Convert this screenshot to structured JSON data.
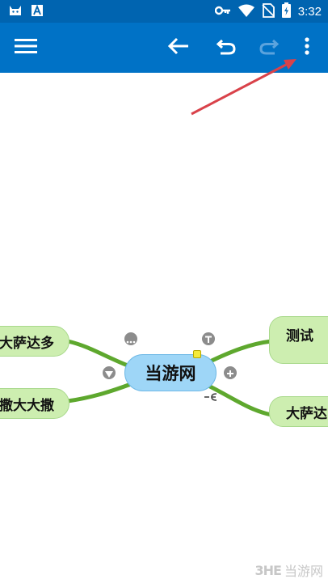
{
  "status_bar": {
    "time": "3:32",
    "left_icons": [
      "cat-notification-icon",
      "text-a-notification-icon"
    ],
    "right_icons": [
      "key-icon",
      "wifi-icon",
      "no-sim-icon",
      "battery-charging-icon"
    ]
  },
  "app_bar": {
    "color": "#0072c6",
    "buttons": [
      "menu-icon",
      "back-arrow-icon",
      "undo-icon",
      "redo-icon",
      "more-vert-icon"
    ]
  },
  "mind_map": {
    "central": {
      "label": "当游网"
    },
    "branches": [
      {
        "label": "大萨达多"
      },
      {
        "label": "撒大大撒"
      },
      {
        "label": "测试"
      },
      {
        "label": "大萨达"
      }
    ],
    "controls": [
      "more-icon",
      "text-icon",
      "collapse-icon",
      "expand-icon"
    ],
    "branch_color": "#5ea82e",
    "node_color": "#cdeeb0",
    "central_color": "#9ed6f7"
  },
  "annotation": {
    "color": "#d9424a"
  },
  "watermark": {
    "logo": "3HE",
    "text": "当游网"
  }
}
